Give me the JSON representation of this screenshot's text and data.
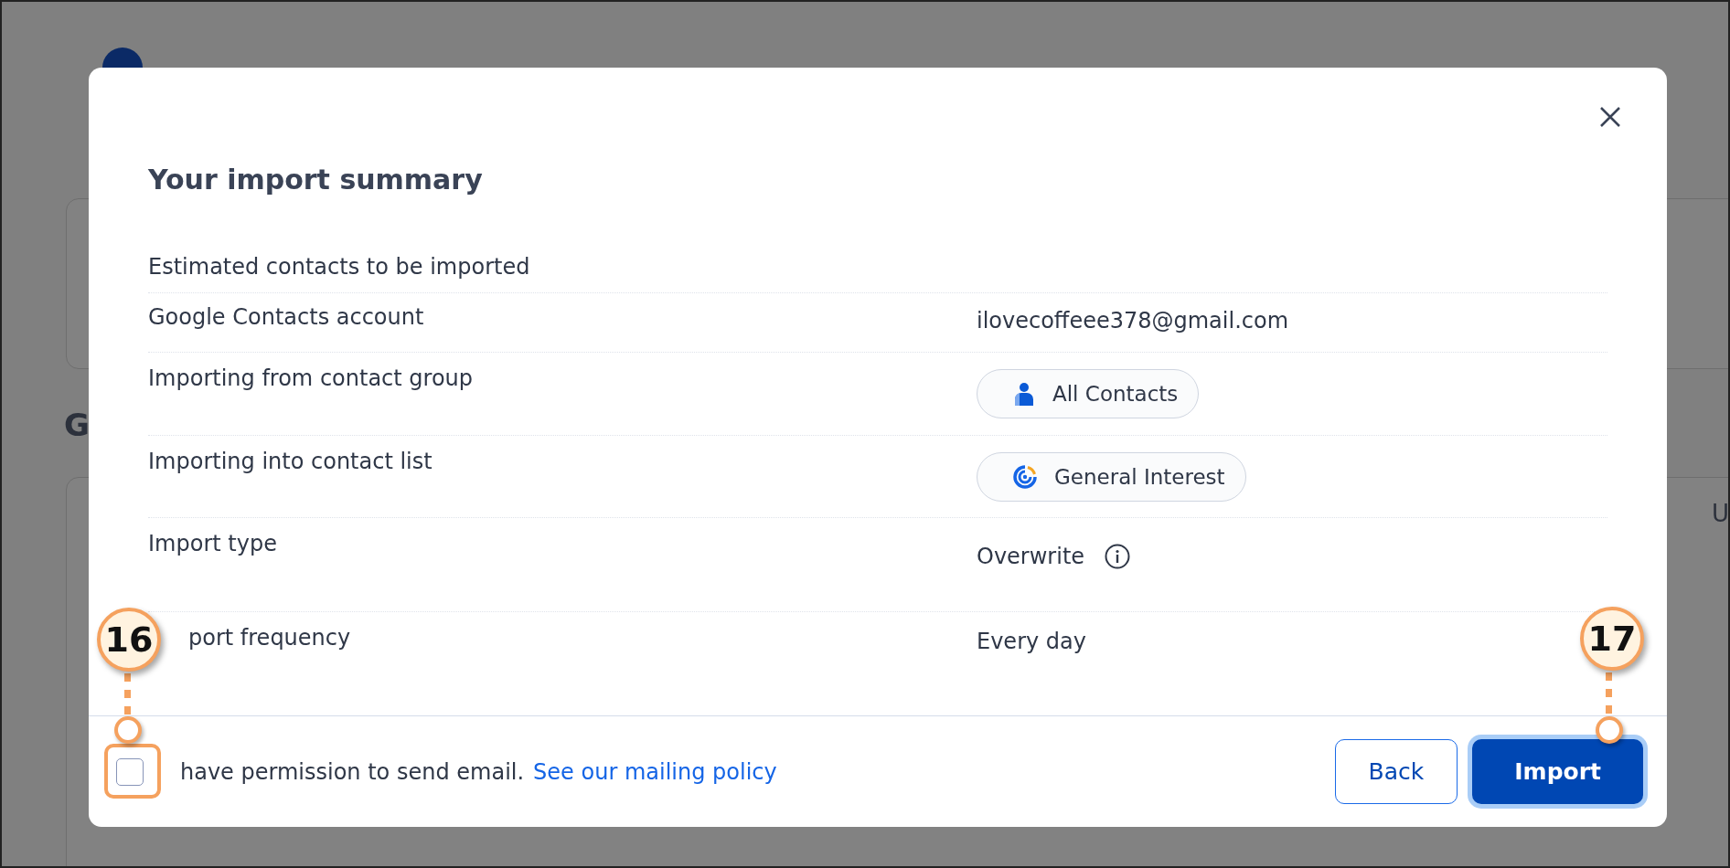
{
  "background": {
    "left_heading": "G",
    "right_table_header": "U"
  },
  "dialog": {
    "title": "Your import summary",
    "rows": [
      {
        "label": "Estimated contacts to be imported",
        "kind": "empty"
      },
      {
        "label": "Google Contacts account",
        "kind": "text",
        "value": "ilovecoffeee378@gmail.com"
      },
      {
        "label": "Importing from contact group",
        "kind": "chip",
        "value": "All Contacts"
      },
      {
        "label": "Importing into contact list",
        "kind": "chip",
        "value": "General Interest"
      },
      {
        "label": "Import type",
        "kind": "info",
        "value": "Overwrite"
      },
      {
        "label": "port frequency",
        "kind": "text",
        "value": "Every day"
      }
    ],
    "permission": {
      "checked": false,
      "text": "have permission to send email.",
      "link": "See our mailing policy"
    },
    "buttons": [
      {
        "label": "Back",
        "kind": "secondary"
      },
      {
        "label": "Import",
        "kind": "primary",
        "focused": true
      }
    ]
  },
  "callouts": [
    {
      "number": "16"
    },
    {
      "number": "17"
    }
  ]
}
